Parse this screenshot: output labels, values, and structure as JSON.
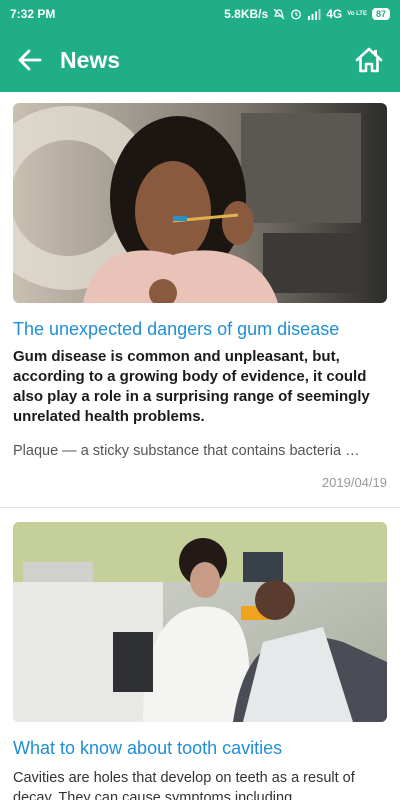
{
  "status_bar": {
    "time": "7:32 PM",
    "network_speed": "5.8KB/s",
    "network_type": "4G",
    "volte": "Vo LTE",
    "battery": "87"
  },
  "app_bar": {
    "title": "News",
    "back_icon": "arrow-left-icon",
    "home_icon": "home-icon"
  },
  "articles": [
    {
      "image": "woman-brushing-teeth-photo",
      "title": "The unexpected dangers of gum disease",
      "summary": "Gum disease is common and unpleasant, but, according to a growing body of evidence, it could also play a role in a surprising range of seemingly unrelated health problems.",
      "excerpt": "Plaque — a sticky substance that contains bacteria …",
      "date": "2019/04/19"
    },
    {
      "image": "dentist-with-patient-photo",
      "title": "What to know about tooth cavities",
      "excerpt": "Cavities are holes that develop on teeth as a result of decay. They can cause symptoms including"
    }
  ],
  "colors": {
    "primary": "#1fae85",
    "title_link": "#1e8fd6",
    "date": "#9a9a9a"
  }
}
